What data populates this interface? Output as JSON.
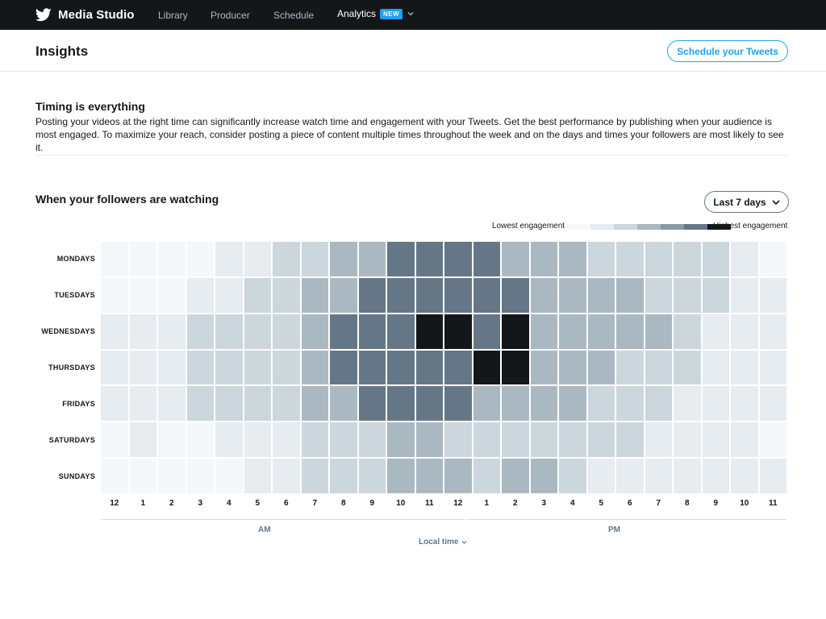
{
  "app": {
    "name": "Media Studio"
  },
  "nav": {
    "items": [
      {
        "label": "Library"
      },
      {
        "label": "Producer"
      },
      {
        "label": "Schedule"
      }
    ],
    "analytics": {
      "label": "Analytics",
      "badge": "NEW"
    }
  },
  "header": {
    "title": "Insights",
    "action_label": "Schedule your Tweets"
  },
  "intro": {
    "title": "Timing is everything",
    "body": "Posting your videos at the right time can significantly increase watch time and engagement with your Tweets. Get the best performance by publishing when your audience is most engaged. To maximize your reach, consider posting a piece of content multiple times throughout the week and on the days and times your followers are most likely to see it."
  },
  "section": {
    "title": "When your followers are watching",
    "range_label": "Last 7 days"
  },
  "legend": {
    "low_label": "Lowest engagement",
    "high_label": "Highest engagement",
    "scale": [
      "#f5f8fa",
      "#e6ecf0",
      "#ccd6dd",
      "#aab8c2",
      "#8899a6",
      "#657786",
      "#14171a"
    ]
  },
  "chart_data": {
    "type": "heatmap",
    "rows": [
      "MONDAYS",
      "TUESDAYS",
      "WEDNESDAYS",
      "THURSDAYS",
      "FRIDAYS",
      "SATURDAYS",
      "SUNDAYS"
    ],
    "columns": [
      "12",
      "1",
      "2",
      "3",
      "4",
      "5",
      "6",
      "7",
      "8",
      "9",
      "10",
      "11",
      "12",
      "1",
      "2",
      "3",
      "4",
      "5",
      "6",
      "7",
      "8",
      "9",
      "10",
      "11"
    ],
    "column_groups": [
      {
        "label": "AM",
        "span": 12
      },
      {
        "label": "PM",
        "span": 12
      }
    ],
    "levels": 7,
    "values": [
      [
        0,
        0,
        0,
        0,
        1,
        1,
        2,
        2,
        3,
        3,
        5,
        5,
        5,
        5,
        3,
        3,
        3,
        2,
        2,
        2,
        2,
        2,
        1,
        0
      ],
      [
        0,
        0,
        0,
        1,
        1,
        2,
        2,
        3,
        3,
        5,
        5,
        5,
        5,
        5,
        5,
        3,
        3,
        3,
        3,
        2,
        2,
        2,
        1,
        1
      ],
      [
        1,
        1,
        1,
        2,
        2,
        2,
        2,
        3,
        5,
        5,
        5,
        6,
        6,
        5,
        6,
        3,
        3,
        3,
        3,
        3,
        2,
        1,
        1,
        1
      ],
      [
        1,
        1,
        1,
        2,
        2,
        2,
        2,
        3,
        5,
        5,
        5,
        5,
        5,
        6,
        6,
        3,
        3,
        3,
        2,
        2,
        2,
        1,
        1,
        1
      ],
      [
        1,
        1,
        1,
        2,
        2,
        2,
        2,
        3,
        3,
        5,
        5,
        5,
        5,
        3,
        3,
        3,
        3,
        2,
        2,
        2,
        1,
        1,
        1,
        1
      ],
      [
        0,
        1,
        0,
        0,
        1,
        1,
        1,
        2,
        2,
        2,
        3,
        3,
        2,
        2,
        2,
        2,
        2,
        2,
        2,
        1,
        1,
        1,
        1,
        0
      ],
      [
        0,
        0,
        0,
        0,
        0,
        1,
        1,
        2,
        2,
        2,
        3,
        3,
        3,
        2,
        3,
        3,
        2,
        1,
        1,
        1,
        1,
        1,
        1,
        1
      ]
    ],
    "x_axis_label": "Local time"
  }
}
